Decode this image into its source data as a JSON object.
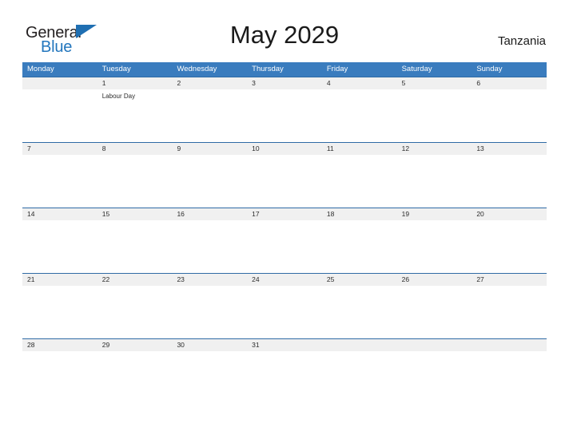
{
  "brand": {
    "name_top": "General",
    "name_bottom": "Blue",
    "top_color": "#231f20",
    "bottom_color": "#2276bd",
    "flag_color": "#1f6fb2"
  },
  "header": {
    "title": "May 2029",
    "country": "Tanzania"
  },
  "theme": {
    "header_bar": "#3a7cbe",
    "week_separator": "#2f6ba5",
    "date_band": "#f0f0f0",
    "text": "#2b2b2b",
    "page_background": "#ffffff"
  },
  "calendar": {
    "month": "May",
    "year": "2029",
    "day_names": [
      "Monday",
      "Tuesday",
      "Wednesday",
      "Thursday",
      "Friday",
      "Saturday",
      "Sunday"
    ],
    "weeks": [
      {
        "days": [
          {
            "date": "",
            "events": []
          },
          {
            "date": "1",
            "events": [
              "Labour Day"
            ]
          },
          {
            "date": "2",
            "events": []
          },
          {
            "date": "3",
            "events": []
          },
          {
            "date": "4",
            "events": []
          },
          {
            "date": "5",
            "events": []
          },
          {
            "date": "6",
            "events": []
          }
        ]
      },
      {
        "days": [
          {
            "date": "7",
            "events": []
          },
          {
            "date": "8",
            "events": []
          },
          {
            "date": "9",
            "events": []
          },
          {
            "date": "10",
            "events": []
          },
          {
            "date": "11",
            "events": []
          },
          {
            "date": "12",
            "events": []
          },
          {
            "date": "13",
            "events": []
          }
        ]
      },
      {
        "days": [
          {
            "date": "14",
            "events": []
          },
          {
            "date": "15",
            "events": []
          },
          {
            "date": "16",
            "events": []
          },
          {
            "date": "17",
            "events": []
          },
          {
            "date": "18",
            "events": []
          },
          {
            "date": "19",
            "events": []
          },
          {
            "date": "20",
            "events": []
          }
        ]
      },
      {
        "days": [
          {
            "date": "21",
            "events": []
          },
          {
            "date": "22",
            "events": []
          },
          {
            "date": "23",
            "events": []
          },
          {
            "date": "24",
            "events": []
          },
          {
            "date": "25",
            "events": []
          },
          {
            "date": "26",
            "events": []
          },
          {
            "date": "27",
            "events": []
          }
        ]
      },
      {
        "days": [
          {
            "date": "28",
            "events": []
          },
          {
            "date": "29",
            "events": []
          },
          {
            "date": "30",
            "events": []
          },
          {
            "date": "31",
            "events": []
          },
          {
            "date": "",
            "events": []
          },
          {
            "date": "",
            "events": []
          },
          {
            "date": "",
            "events": []
          }
        ]
      }
    ]
  }
}
